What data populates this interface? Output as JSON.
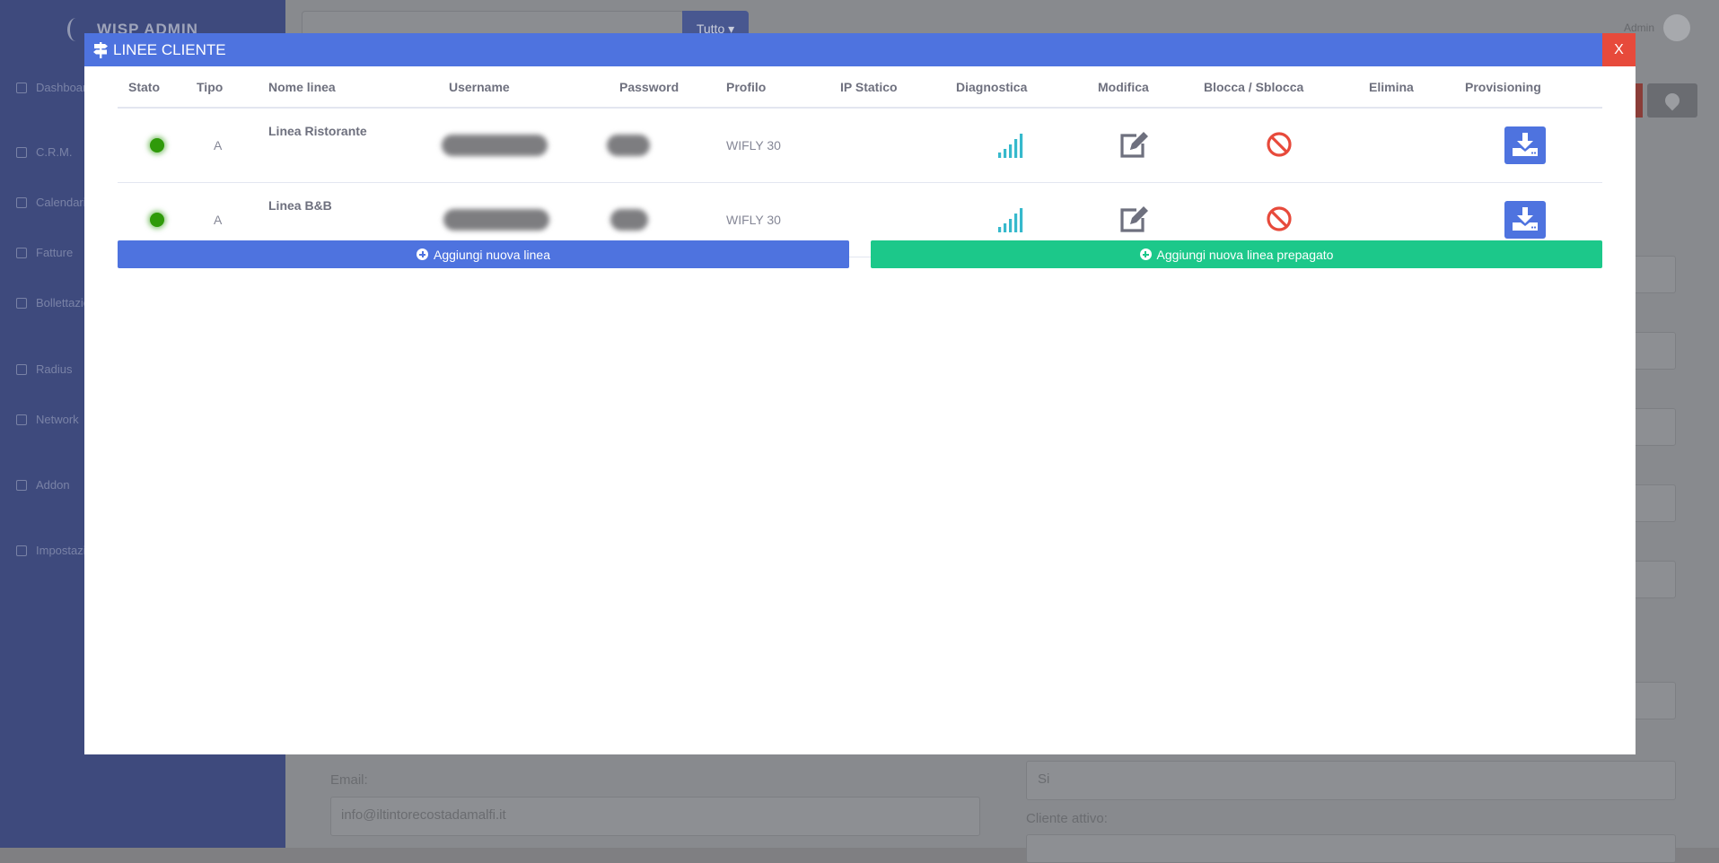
{
  "background": {
    "brand": "WISP ADMIN",
    "sidebar_items": [
      "Dashboard",
      "C.R.M.",
      "Calendario",
      "Fatture",
      "Bollettazione",
      "Radius",
      "Network",
      "Addon",
      "Impostazioni"
    ],
    "search_dropdown_label": "Tutto",
    "user_name": "Admin",
    "email_label": "Email:",
    "email_value": "info@iltintorecostadamalfi.it",
    "select_value": "Si",
    "cliente_attivo_label": "Cliente attivo:"
  },
  "modal": {
    "title": "LINEE CLIENTE",
    "close_label": "X",
    "columns": [
      "Stato",
      "Tipo",
      "Nome linea",
      "Username",
      "Password",
      "Profilo",
      "IP Statico",
      "Diagnostica",
      "Modifica",
      "Blocca / Sblocca",
      "Elimina",
      "Provisioning"
    ],
    "rows": [
      {
        "tipo": "A",
        "name": "Linea Ristorante",
        "profilo": "WIFLY 30",
        "ip": ""
      },
      {
        "tipo": "A",
        "name": "Linea B&B",
        "profilo": "WIFLY 30",
        "ip": ""
      }
    ],
    "add_line_label": "Aggiungi nuova linea",
    "add_prepaid_label": "Aggiungi nuova linea prepagato"
  },
  "colors": {
    "primary": "#4e73df",
    "success": "#1cc88a",
    "danger": "#e74a3b",
    "status_active": "#2f9a0a",
    "diagnostic": "#36b9cc"
  }
}
